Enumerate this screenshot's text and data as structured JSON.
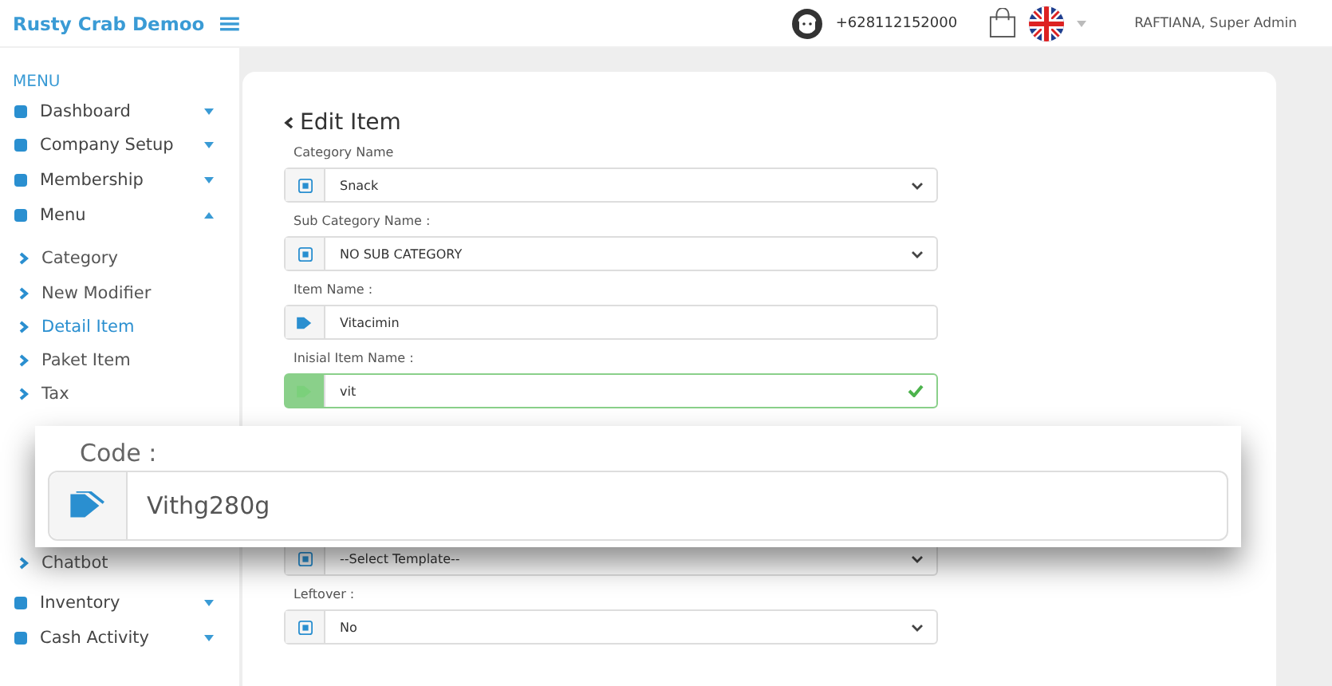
{
  "header": {
    "brand": "Rusty Crab Demoo",
    "phone": "+628112152000",
    "user": "RAFTIANA, Super Admin"
  },
  "sidebar": {
    "heading": "MENU",
    "items": [
      {
        "label": "Dashboard",
        "expanded": false
      },
      {
        "label": "Company Setup",
        "expanded": false
      },
      {
        "label": "Membership",
        "expanded": false
      },
      {
        "label": "Menu",
        "expanded": true,
        "children": [
          {
            "label": "Category",
            "selected": false
          },
          {
            "label": "New Modifier",
            "selected": false
          },
          {
            "label": "Detail Item",
            "selected": true
          },
          {
            "label": "Paket Item",
            "selected": false
          },
          {
            "label": "Tax",
            "selected": false
          },
          {
            "label": "Chatbot",
            "selected": false
          }
        ]
      },
      {
        "label": "Inventory",
        "expanded": false
      },
      {
        "label": "Cash Activity",
        "expanded": false
      }
    ]
  },
  "page": {
    "title": "Edit Item",
    "fields": [
      {
        "kind": "select",
        "label": "Category Name",
        "value": "Snack",
        "valid": false
      },
      {
        "kind": "select",
        "label": "Sub Category Name :",
        "value": "NO SUB CATEGORY",
        "valid": false
      },
      {
        "kind": "text",
        "label": "Item Name :",
        "value": "Vitacimin",
        "valid": false
      },
      {
        "kind": "text",
        "label": "Inisial Item Name :",
        "value": "vit",
        "valid": true
      },
      {
        "kind": "select",
        "value": "--Select Template--",
        "valid": false
      },
      {
        "kind": "select",
        "label": "Leftover :",
        "value": "No",
        "valid": false
      }
    ]
  },
  "zoom_overlay": {
    "label": "Code :",
    "value": "Vithg280g"
  }
}
